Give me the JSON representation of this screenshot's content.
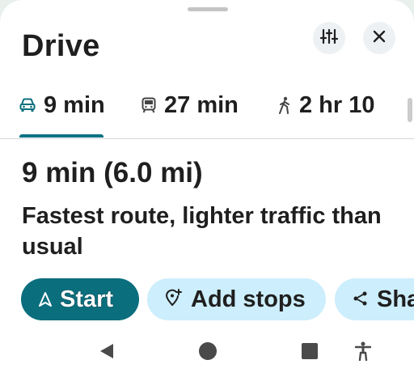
{
  "sheet": {
    "title": "Drive"
  },
  "header_buttons": [
    {
      "name": "route-options",
      "icon": "tune-sliders-icon"
    },
    {
      "name": "close",
      "icon": "close-icon"
    }
  ],
  "tabs": [
    {
      "label": "9 min",
      "icon": "car-icon",
      "selected": true
    },
    {
      "label": "27 min",
      "icon": "transit-icon",
      "selected": false
    },
    {
      "label": "2 hr 10",
      "icon": "walk-icon",
      "selected": false
    }
  ],
  "route": {
    "duration": "9 min",
    "distance": "(6.0 mi)",
    "description": "Fastest route, lighter traffic than usual"
  },
  "actions": {
    "start_label": "Start",
    "add_stops_label": "Add stops",
    "share_label": "Sha"
  },
  "navbar": {
    "buttons": [
      "back-icon",
      "home-icon",
      "recents-icon",
      "accessibility-icon"
    ]
  },
  "colors": {
    "accent": "#0b6e7d",
    "chip_bg": "#cdeefc",
    "icon_bg": "#eef1f3"
  }
}
